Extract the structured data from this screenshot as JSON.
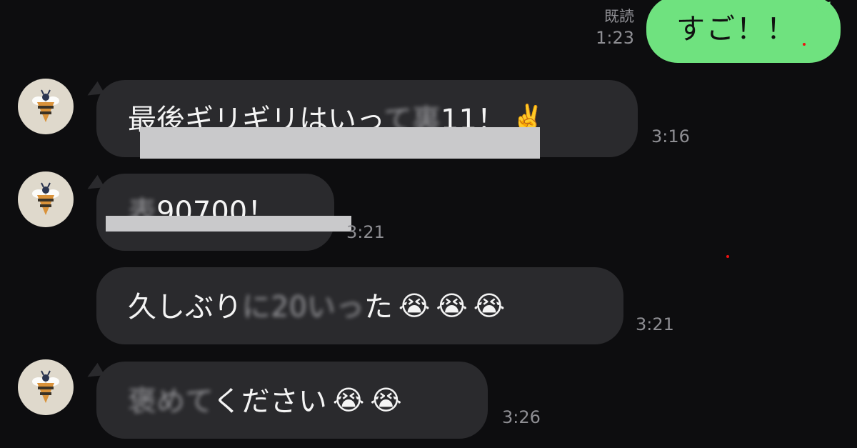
{
  "outgoing": {
    "read_label": "既読",
    "time": "1:23",
    "text": "すご！！"
  },
  "messages": [
    {
      "text_visible": "最後ギリギリはいっ",
      "text_blurred": "て裏",
      "text_tail": "11！",
      "emoji": [
        "✌️"
      ],
      "time": "3:16",
      "show_avatar": true
    },
    {
      "text_blurred": "表",
      "text_visible": "90700！",
      "time": "3:21",
      "show_avatar": true
    },
    {
      "text_visible": "久しぶり",
      "text_blurred": "に20いっ",
      "text_tail": "た",
      "emoji": [
        "😭",
        "😭",
        "😭"
      ],
      "time": "3:21",
      "show_avatar": false
    },
    {
      "text_blurred": "褒めて",
      "text_visible": "ください",
      "emoji": [
        "😭",
        "😭"
      ],
      "time": "3:26",
      "show_avatar": true
    }
  ],
  "colors": {
    "background": "#0d0d0f",
    "incoming_bubble": "#2a2a2d",
    "outgoing_bubble": "#6fe27f",
    "meta_text": "#8e8e93",
    "redaction": "#c9c9cb"
  },
  "icons": {
    "avatar": "bee-avatar-icon"
  }
}
